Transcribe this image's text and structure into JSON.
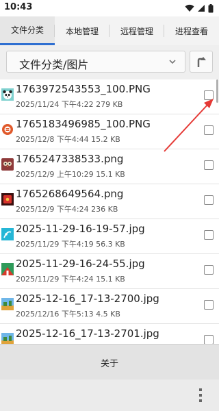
{
  "status_bar": {
    "time": "10:43",
    "icons": [
      "wifi-icon",
      "signal-icon",
      "battery-icon"
    ]
  },
  "tabs": [
    {
      "label": "文件分类",
      "active": true
    },
    {
      "label": "本地管理",
      "active": false
    },
    {
      "label": "远程管理",
      "active": false
    },
    {
      "label": "进程查看",
      "active": false
    }
  ],
  "path_bar": {
    "current_path": "文件分类/图片",
    "up_icon": "up-arrow-icon"
  },
  "files": [
    {
      "name": "1763972543553_100.PNG",
      "date": "2025/11/24",
      "time": "下午4:22",
      "size": "279 KB",
      "checked": false,
      "icon": "panda-thumbnail"
    },
    {
      "name": "1765183496985_100.PNG",
      "date": "2025/12/8",
      "time": "下午4:44",
      "size": "15.2 KB",
      "checked": false,
      "icon": "orange-badge-thumbnail"
    },
    {
      "name": "1765247338533.png",
      "date": "2025/12/9",
      "time": "上午10:29",
      "size": "15.1 KB",
      "checked": false,
      "icon": "owl-thumbnail"
    },
    {
      "name": "1765268649564.png",
      "date": "2025/12/9",
      "time": "下午4:24",
      "size": "236 KB",
      "checked": false,
      "icon": "red-envelope-thumbnail"
    },
    {
      "name": "2025-11-29-16-19-57.jpg",
      "date": "2025/11/29",
      "time": "下午4:19",
      "size": "56.3 KB",
      "checked": false,
      "icon": "cyan-thumbnail"
    },
    {
      "name": "2025-11-29-16-24-55.jpg",
      "date": "2025/11/29",
      "time": "下午4:24",
      "size": "15.1 KB",
      "checked": false,
      "icon": "green-red-thumbnail"
    },
    {
      "name": "2025-12-16_17-13-2700.jpg",
      "date": "2025/12/16",
      "time": "下午5:13",
      "size": "4.5 KB",
      "checked": false,
      "icon": "landscape-thumbnail"
    },
    {
      "name": "2025-12-16_17-13-2701.jpg",
      "date": "",
      "time": "",
      "size": "",
      "checked": false,
      "icon": "landscape-thumbnail"
    }
  ],
  "bottom_bar": {
    "about_label": "关于"
  },
  "nav_bar": {
    "menu_icon": "overflow-menu-icon"
  },
  "annotation": {
    "color": "#e53935",
    "icon": "red-arrow-annotation"
  },
  "colors": {
    "accent": "#2f6fd1"
  }
}
